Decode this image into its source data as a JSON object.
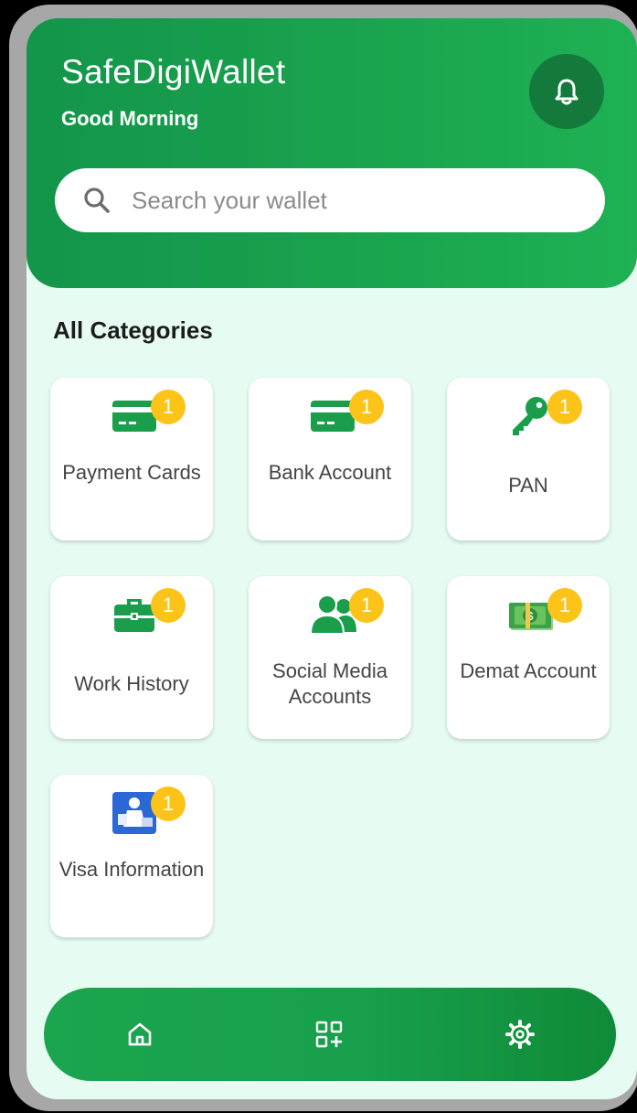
{
  "header": {
    "app_title": "SafeDigiWallet",
    "greeting": "Good Morning",
    "notification_icon": "bell-icon"
  },
  "search": {
    "placeholder": "Search your wallet",
    "icon": "search-icon"
  },
  "categories": {
    "title": "All Categories",
    "items": [
      {
        "label": "Payment Cards",
        "badge": "1",
        "icon": "credit-card-icon"
      },
      {
        "label": "Bank Account",
        "badge": "1",
        "icon": "credit-card-icon"
      },
      {
        "label": "PAN",
        "badge": "1",
        "icon": "key-icon"
      },
      {
        "label": "Work History",
        "badge": "1",
        "icon": "briefcase-icon"
      },
      {
        "label": "Social Media Accounts",
        "badge": "1",
        "icon": "users-icon"
      },
      {
        "label": "Demat Account",
        "badge": "1",
        "icon": "money-icon"
      },
      {
        "label": "Visa Information",
        "badge": "1",
        "icon": "passport-control-icon"
      }
    ]
  },
  "bottom_nav": {
    "items": [
      {
        "name": "home",
        "icon": "home-icon"
      },
      {
        "name": "add-category",
        "icon": "grid-plus-icon"
      },
      {
        "name": "settings",
        "icon": "gear-icon"
      }
    ]
  },
  "colors": {
    "primary_green": "#1aa54f",
    "dark_green": "#137a3c",
    "background": "#e6fcf3",
    "badge": "#fcc419",
    "icon_green": "#1a9e4c"
  }
}
